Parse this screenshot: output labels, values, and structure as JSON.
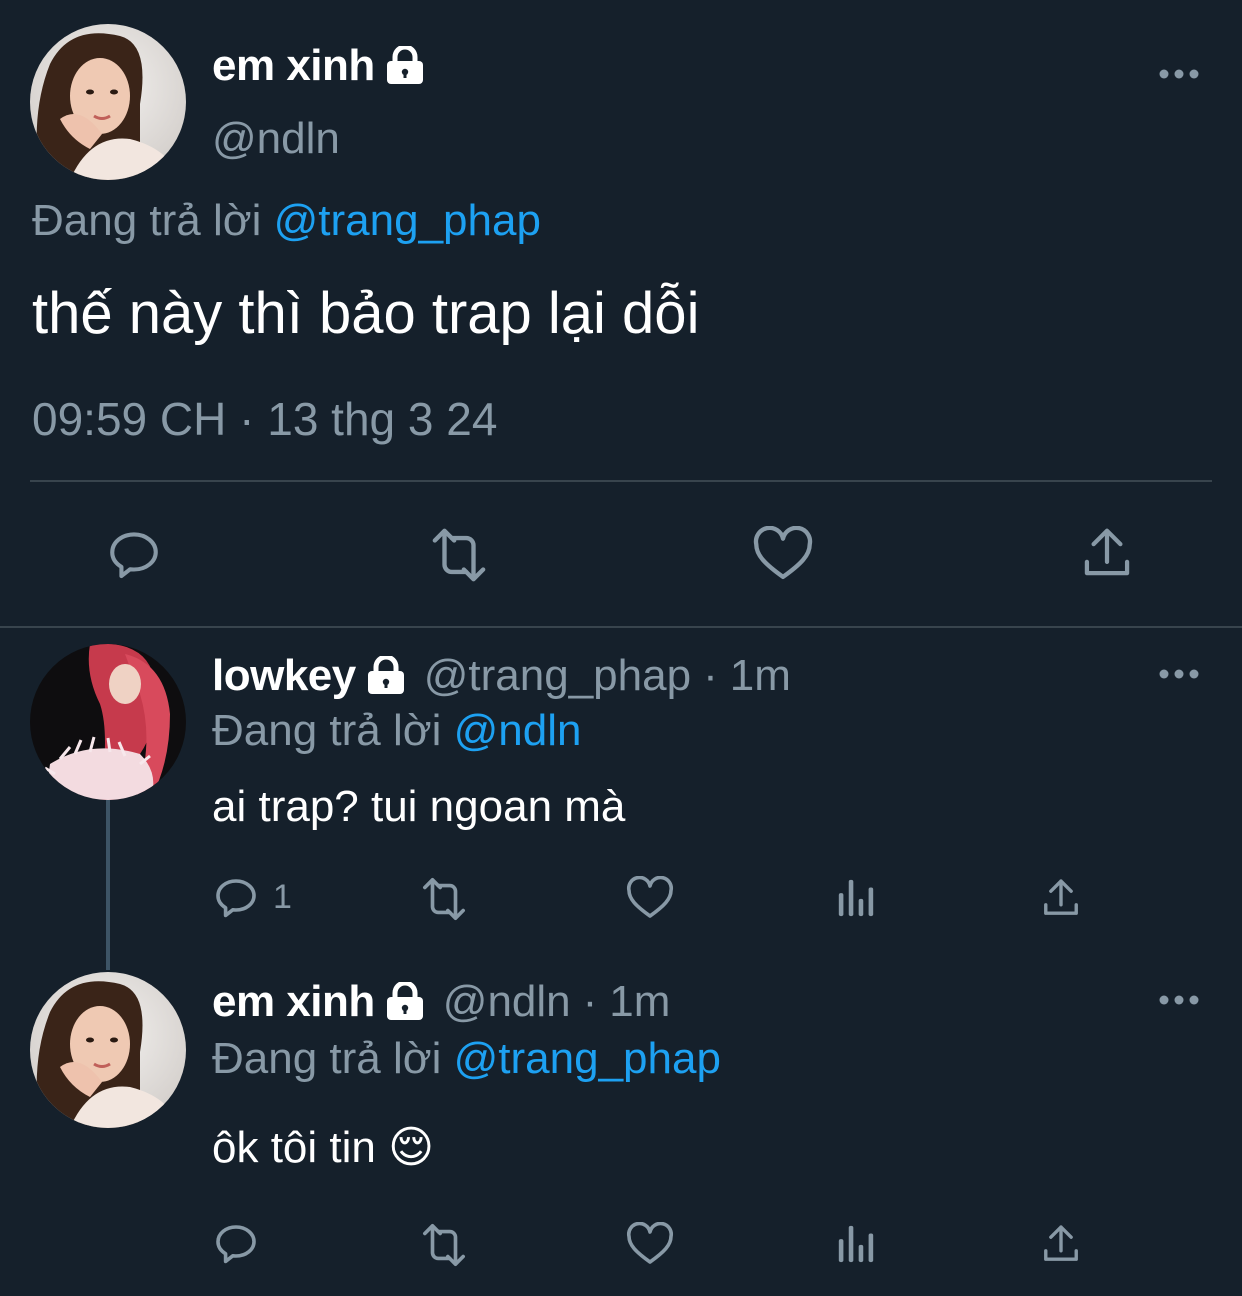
{
  "main_tweet": {
    "display_name": "em xinh",
    "handle": "@ndln",
    "replying_prefix": "Đang trả lời",
    "replying_to": "@trang_phap",
    "text": "thế này thì bảo trap lại dỗi",
    "time": "09:59 CH",
    "separator": "·",
    "date": "13 thg 3 24"
  },
  "reply_1": {
    "display_name": "lowkey",
    "handle": "@trang_phap",
    "separator": "·",
    "time_ago": "1m",
    "replying_prefix": "Đang trả lời",
    "replying_to": "@ndln",
    "text": "ai trap? tui ngoan mà",
    "reply_count": "1"
  },
  "reply_2": {
    "display_name": "em xinh",
    "handle": "@ndln",
    "separator": "·",
    "time_ago": "1m",
    "replying_prefix": "Đang trả lời",
    "replying_to": "@trang_phap",
    "text": "ôk tôi tin 😌"
  },
  "colors": {
    "background": "#15202b",
    "muted": "#8899a6",
    "link": "#1da1f2",
    "divider": "#38444d"
  },
  "icons": [
    "lock-icon",
    "more-icon",
    "reply-icon",
    "retweet-icon",
    "like-icon",
    "share-icon",
    "analytics-icon"
  ]
}
